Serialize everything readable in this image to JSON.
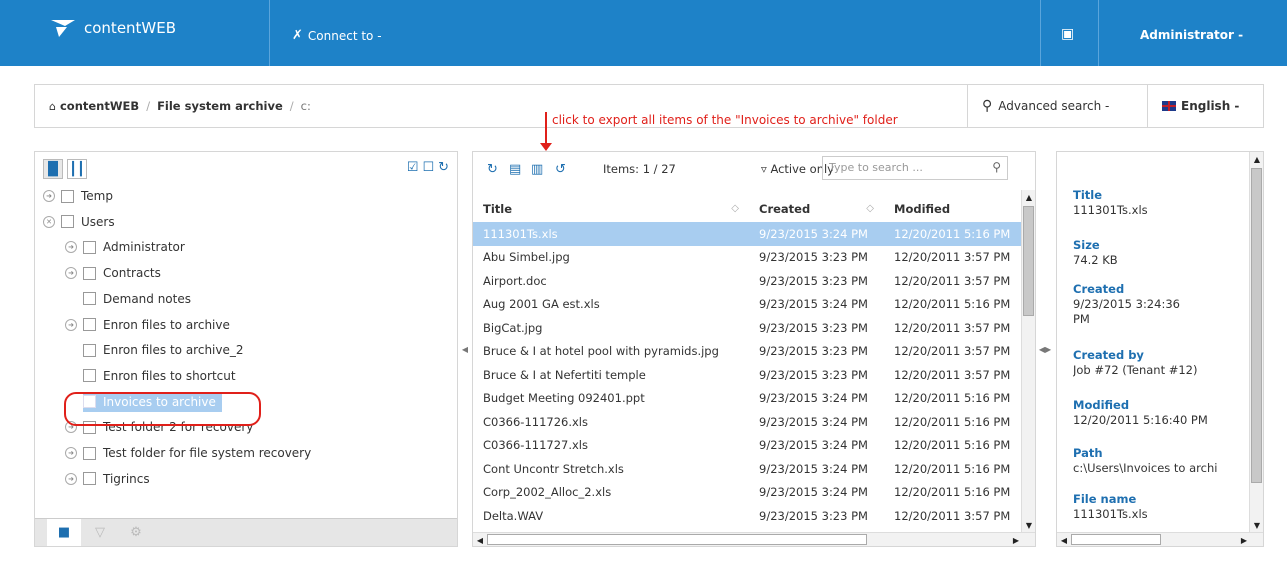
{
  "app": {
    "title": "contentWEB",
    "connect_label": "Connect to -",
    "user_label": "Administrator -"
  },
  "breadcrumb": {
    "root": "contentWEB",
    "archive": "File system archive",
    "drive": "c:"
  },
  "header_actions": {
    "advanced_search": "Advanced search -",
    "language": "English -"
  },
  "annotation": "click to export all items of the \"Invoices to archive\" folder",
  "tree": [
    {
      "label": "Temp",
      "expandable": true,
      "level": 0
    },
    {
      "label": "Users",
      "expandable": true,
      "level": 0
    },
    {
      "label": "Administrator",
      "expandable": true,
      "level": 1
    },
    {
      "label": "Contracts",
      "expandable": true,
      "level": 1
    },
    {
      "label": "Demand notes",
      "expandable": false,
      "level": 1
    },
    {
      "label": "Enron files to archive",
      "expandable": true,
      "level": 1
    },
    {
      "label": "Enron files to archive_2",
      "expandable": false,
      "level": 1
    },
    {
      "label": "Enron files to shortcut",
      "expandable": false,
      "level": 1
    },
    {
      "label": "Invoices to archive",
      "expandable": false,
      "level": 1,
      "selected": true
    },
    {
      "label": "Test folder 2 for recovery",
      "expandable": true,
      "level": 1
    },
    {
      "label": "Test folder for file system recovery",
      "expandable": true,
      "level": 1
    },
    {
      "label": "Tigrincs",
      "expandable": true,
      "level": 1
    }
  ],
  "list": {
    "items_label": "Items: 1 / 27",
    "active_only": "Active only",
    "search_placeholder": "Type to search ...",
    "columns": [
      "Title",
      "Created",
      "Modified"
    ],
    "rows": [
      [
        "111301Ts.xls",
        "9/23/2015 3:24 PM",
        "12/20/2011 5:16 PM"
      ],
      [
        "Abu Simbel.jpg",
        "9/23/2015 3:23 PM",
        "12/20/2011 3:57 PM"
      ],
      [
        "Airport.doc",
        "9/23/2015 3:23 PM",
        "12/20/2011 3:57 PM"
      ],
      [
        "Aug 2001 GA est.xls",
        "9/23/2015 3:24 PM",
        "12/20/2011 5:16 PM"
      ],
      [
        "BigCat.jpg",
        "9/23/2015 3:23 PM",
        "12/20/2011 3:57 PM"
      ],
      [
        "Bruce & I at hotel pool with pyramids.jpg",
        "9/23/2015 3:23 PM",
        "12/20/2011 3:57 PM"
      ],
      [
        "Bruce & I at Nefertiti temple",
        "9/23/2015 3:23 PM",
        "12/20/2011 3:57 PM"
      ],
      [
        "Budget Meeting 092401.ppt",
        "9/23/2015 3:24 PM",
        "12/20/2011 5:16 PM"
      ],
      [
        "C0366-111726.xls",
        "9/23/2015 3:24 PM",
        "12/20/2011 5:16 PM"
      ],
      [
        "C0366-111727.xls",
        "9/23/2015 3:24 PM",
        "12/20/2011 5:16 PM"
      ],
      [
        "Cont Uncontr Stretch.xls",
        "9/23/2015 3:24 PM",
        "12/20/2011 5:16 PM"
      ],
      [
        "Corp_2002_Alloc_2.xls",
        "9/23/2015 3:24 PM",
        "12/20/2011 5:16 PM"
      ],
      [
        "Delta.WAV",
        "9/23/2015 3:23 PM",
        "12/20/2011 3:57 PM"
      ]
    ]
  },
  "properties": [
    {
      "key": "Title",
      "value": "111301Ts.xls"
    },
    {
      "key": "Size",
      "value": "74.2 KB"
    },
    {
      "key": "Created",
      "value": "9/23/2015 3:24:36 PM"
    },
    {
      "key": "Created by",
      "value": "Job #72 (Tenant #12)"
    },
    {
      "key": "Modified",
      "value": "12/20/2011 5:16:40 PM"
    },
    {
      "key": "Path",
      "value": "c:\\Users\\Invoices to archi"
    },
    {
      "key": "File name",
      "value": "111301Ts.xls"
    }
  ],
  "colors": {
    "topbar": "#1e82c8",
    "accent": "#1e6fb0",
    "selection": "#a8cdf0",
    "annotation": "#e0201a"
  }
}
